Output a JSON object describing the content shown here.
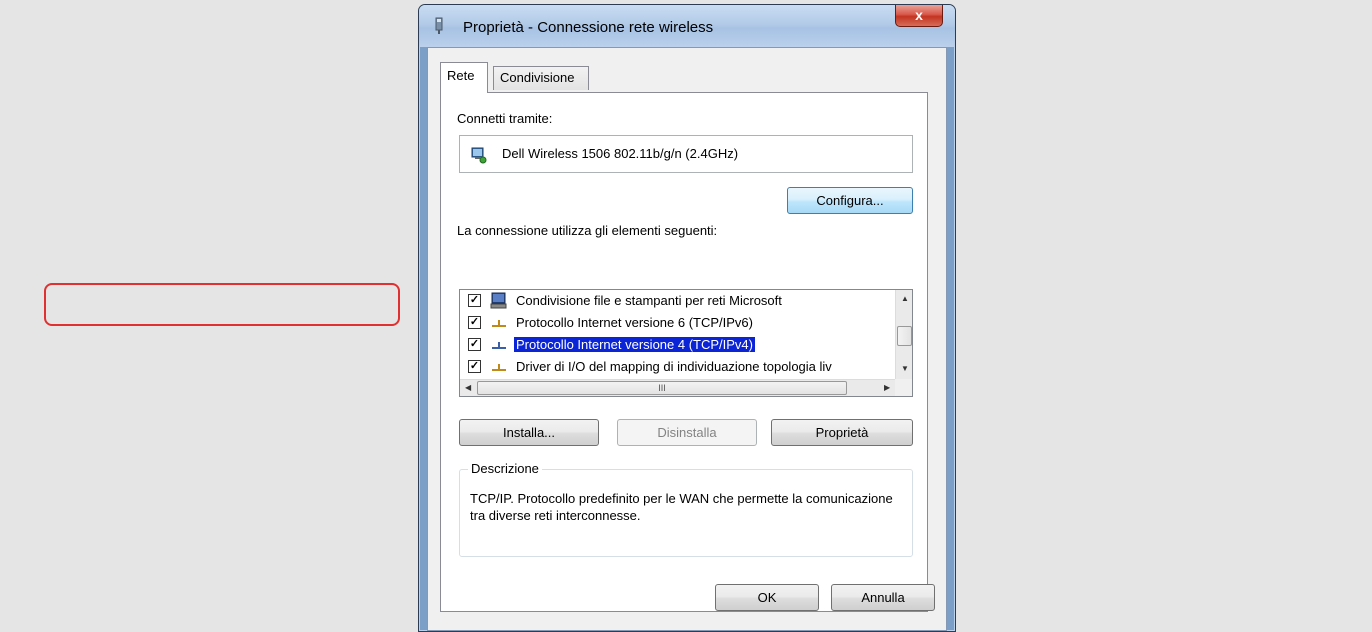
{
  "window": {
    "title": "Proprietà - Connessione rete wireless",
    "close_label": "x"
  },
  "tabs": [
    {
      "label": "Rete",
      "active": true
    },
    {
      "label": "Condivisione",
      "active": false
    }
  ],
  "connect_via": {
    "label": "Connetti tramite:",
    "adapter_name": "Dell Wireless 1506 802.11b/g/n (2.4GHz)",
    "configure_button": "Configura..."
  },
  "components": {
    "label": "La connessione utilizza gli elementi seguenti:",
    "items": [
      {
        "checked": true,
        "icon": "network-client-icon",
        "label": "Condivisione file e stampanti per reti Microsoft",
        "selected": false
      },
      {
        "checked": true,
        "icon": "protocol-icon",
        "label": "Protocollo Internet versione 6 (TCP/IPv6)",
        "selected": false
      },
      {
        "checked": true,
        "icon": "protocol-icon",
        "label": "Protocollo Internet versione 4 (TCP/IPv4)",
        "selected": true
      },
      {
        "checked": true,
        "icon": "protocol-icon",
        "label": "Driver di I/O del mapping di individuazione topologia liv",
        "selected": false
      }
    ],
    "hscroll_grip": "III"
  },
  "actions": {
    "install": "Installa...",
    "uninstall": "Disinstalla",
    "properties": "Proprietà"
  },
  "description": {
    "title": "Descrizione",
    "text": "TCP/IP. Protocollo predefinito per le WAN che permette la comunicazione tra diverse reti interconnesse."
  },
  "footer": {
    "ok": "OK",
    "cancel": "Annulla"
  },
  "colors": {
    "selection": "#0a24d6",
    "highlight_ring": "#e03030",
    "desktop_bg": "#e5e5e5"
  }
}
